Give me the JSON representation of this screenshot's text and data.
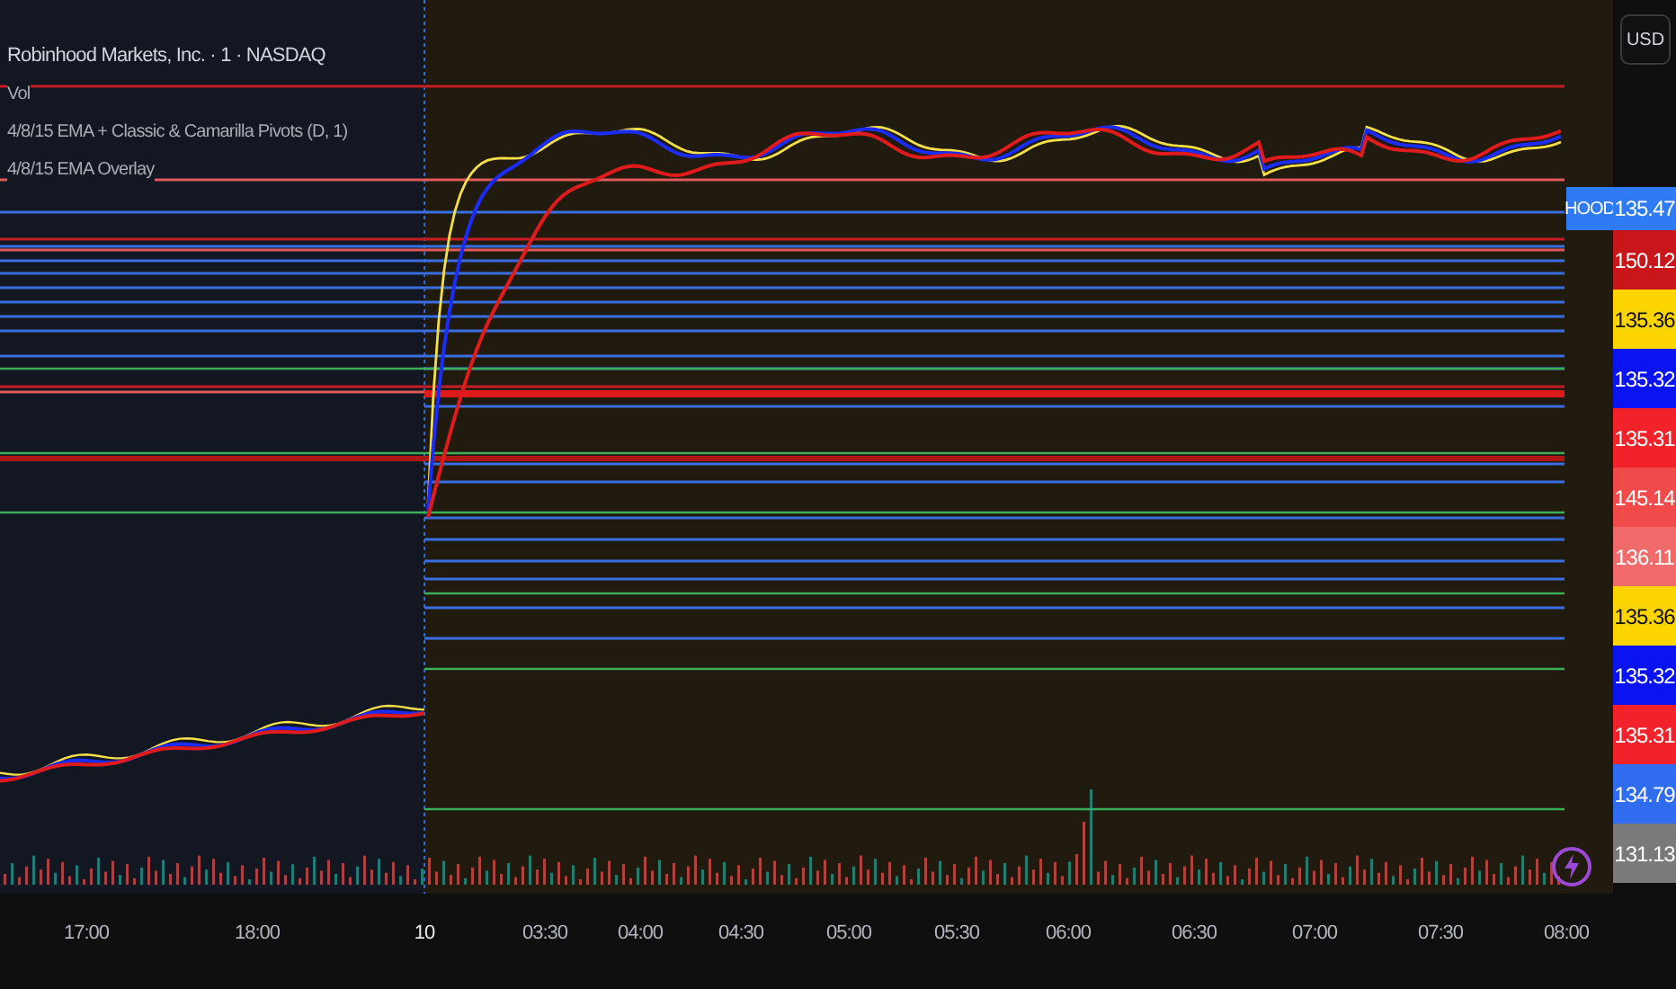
{
  "legend": {
    "title": "Robinhood Markets, Inc. · 1 · NASDAQ",
    "indicators": [
      "Vol",
      "4/8/15 EMA + Classic & Camarilla Pivots (D, 1)",
      "4/8/15 EMA Overlay"
    ]
  },
  "currency_button": "USD",
  "symbol_tag": {
    "text": "HOOD",
    "price": "135.47",
    "color": "#2f7bf5"
  },
  "price_labels": [
    {
      "text": "150.12",
      "color": "#c8161b"
    },
    {
      "text": "135.36",
      "color": "#ffd500"
    },
    {
      "text": "135.32",
      "color": "#0a14f0"
    },
    {
      "text": "135.31",
      "color": "#f2222a"
    },
    {
      "text": "145.14",
      "color": "#f04a4a"
    },
    {
      "text": "136.11",
      "color": "#f26b6b"
    },
    {
      "text": "135.36",
      "color": "#ffd500"
    },
    {
      "text": "135.32",
      "color": "#0a14f0"
    },
    {
      "text": "135.31",
      "color": "#f2222a"
    },
    {
      "text": "134.79",
      "color": "#2f6cf0"
    },
    {
      "text": "131.13",
      "color": "#7a7a7a"
    }
  ],
  "time_labels": [
    "17:00",
    "18:00",
    "10",
    "03:30",
    "04:00",
    "04:30",
    "05:00",
    "05:30",
    "06:00",
    "06:30",
    "07:00",
    "07:30",
    "08:00"
  ]
}
